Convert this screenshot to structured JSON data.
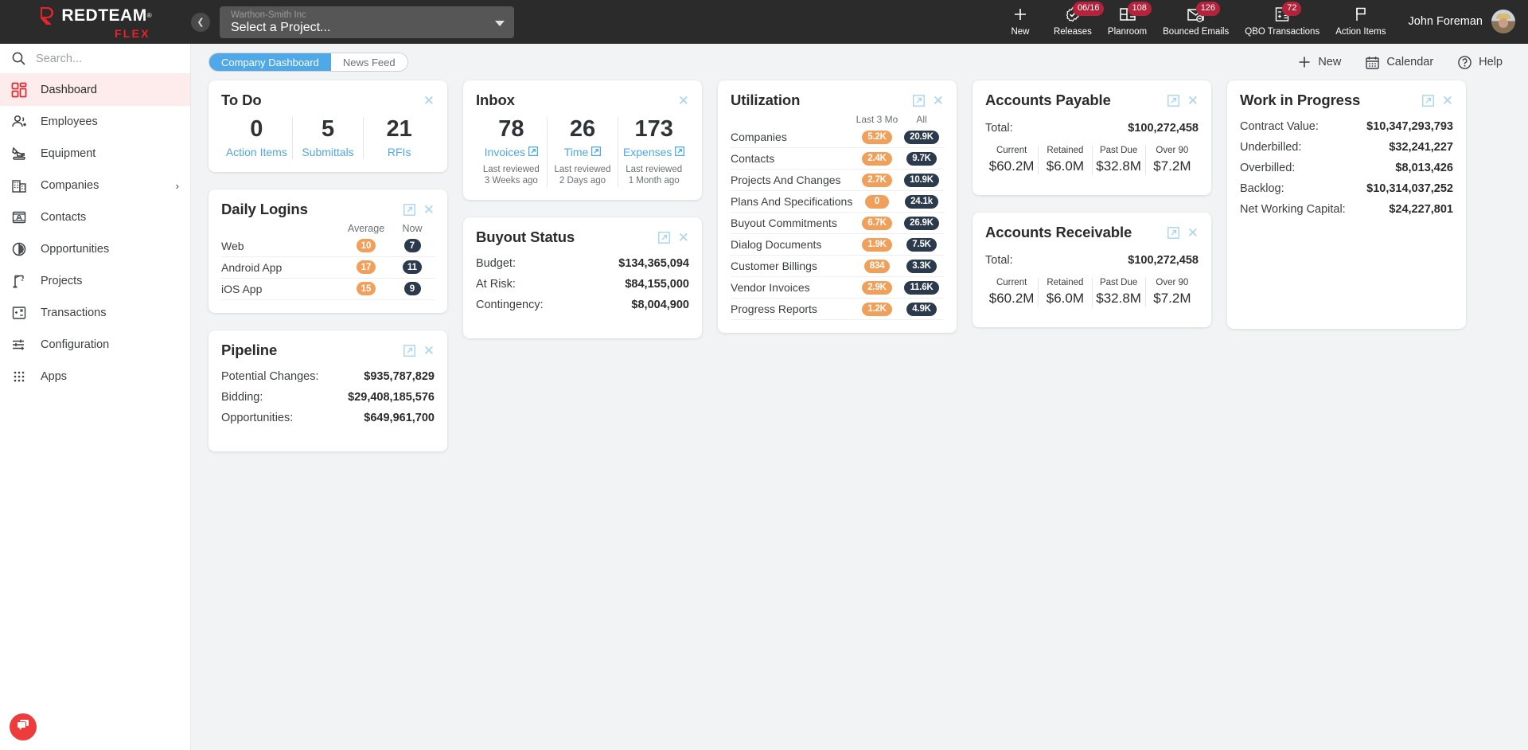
{
  "brand": {
    "name": "REDTEAM",
    "registered": "®",
    "sub": "FLEX",
    "accent": "#e8232a"
  },
  "topbar": {
    "collapse_icon": "chevron-left-icon",
    "project_selector": {
      "company": "Warthon-Smith Inc",
      "value": "Select a Project...",
      "caret_icon": "caret-down-icon"
    },
    "nav": [
      {
        "label": "New",
        "icon": "plus-icon",
        "badge": ""
      },
      {
        "label": "Releases",
        "icon": "badge-check-icon",
        "badge": "06/16"
      },
      {
        "label": "Planroom",
        "icon": "planroom-icon",
        "badge": "108"
      },
      {
        "label": "Bounced Emails",
        "icon": "envelope-minus-icon",
        "badge": "126"
      },
      {
        "label": "QBO Transactions",
        "icon": "calculator-icon",
        "badge": "72"
      },
      {
        "label": "Action Items",
        "icon": "flag-icon",
        "badge": ""
      }
    ],
    "user": {
      "name": "John Foreman",
      "avatar": "avatar"
    }
  },
  "sidebar": {
    "search": {
      "placeholder": "Search...",
      "value": "",
      "icon": "search-icon"
    },
    "items": [
      {
        "label": "Dashboard",
        "icon": "dashboard-icon",
        "active": true,
        "chevron": ""
      },
      {
        "label": "Employees",
        "icon": "employees-icon",
        "active": false,
        "chevron": ""
      },
      {
        "label": "Equipment",
        "icon": "equipment-icon",
        "active": false,
        "chevron": ""
      },
      {
        "label": "Companies",
        "icon": "companies-icon",
        "active": false,
        "chevron": "›"
      },
      {
        "label": "Contacts",
        "icon": "contacts-icon",
        "active": false,
        "chevron": ""
      },
      {
        "label": "Opportunities",
        "icon": "opportunities-icon",
        "active": false,
        "chevron": ""
      },
      {
        "label": "Projects",
        "icon": "projects-icon",
        "active": false,
        "chevron": ""
      },
      {
        "label": "Transactions",
        "icon": "transactions-icon",
        "active": false,
        "chevron": ""
      },
      {
        "label": "Configuration",
        "icon": "configuration-icon",
        "active": false,
        "chevron": ""
      },
      {
        "label": "Apps",
        "icon": "apps-grid-icon",
        "active": false,
        "chevron": ""
      }
    ],
    "chat_button": {
      "icon": "chat-bubble-icon",
      "color": "#ee3b3b"
    }
  },
  "content_header": {
    "tabs": [
      {
        "label": "Company Dashboard",
        "active": true
      },
      {
        "label": "News Feed",
        "active": false
      }
    ],
    "actions": [
      {
        "label": "New",
        "icon": "plus-icon"
      },
      {
        "label": "Calendar",
        "icon": "calendar-icon"
      },
      {
        "label": "Help",
        "icon": "question-circle-icon"
      }
    ],
    "active_tab_color": "#4fa8e8"
  },
  "cards": {
    "todo": {
      "title": "To Do",
      "close_icon": "close-icon",
      "stats": [
        {
          "value": "0",
          "label": "Action Items",
          "external": false
        },
        {
          "value": "5",
          "label": "Submittals",
          "external": false
        },
        {
          "value": "21",
          "label": "RFIs",
          "external": false
        }
      ]
    },
    "inbox": {
      "title": "Inbox",
      "close_icon": "close-icon",
      "stats": [
        {
          "value": "78",
          "label": "Invoices",
          "external": true,
          "sub": "Last reviewed\n3 Weeks ago",
          "sub_line1": "Last reviewed",
          "sub_line2": "3 Weeks ago"
        },
        {
          "value": "26",
          "label": "Time",
          "external": true,
          "sub_line1": "Last reviewed",
          "sub_line2": "2 Days ago"
        },
        {
          "value": "173",
          "label": "Expenses",
          "external": true,
          "sub_line1": "Last reviewed",
          "sub_line2": "1 Month ago"
        }
      ]
    },
    "utilization": {
      "title": "Utilization",
      "expand_icon": "external-link-icon",
      "close_icon": "close-icon",
      "col_headers": [
        "Last 3 Mo",
        "All"
      ],
      "rows": [
        {
          "name": "Companies",
          "last3mo": "5.2K",
          "all": "20.9K"
        },
        {
          "name": "Contacts",
          "last3mo": "2.4K",
          "all": "9.7K"
        },
        {
          "name": "Projects And Changes",
          "last3mo": "2.7K",
          "all": "10.9K"
        },
        {
          "name": "Plans And Specifications",
          "last3mo": "0",
          "all": "24.1k"
        },
        {
          "name": "Buyout Commitments",
          "last3mo": "6.7K",
          "all": "26.9K"
        },
        {
          "name": "Dialog Documents",
          "last3mo": "1.9K",
          "all": "7.5K"
        },
        {
          "name": "Customer Billings",
          "last3mo": "834",
          "all": "3.3K"
        },
        {
          "name": "Vendor Invoices",
          "last3mo": "2.9K",
          "all": "11.6K"
        },
        {
          "name": "Progress Reports",
          "last3mo": "1.2K",
          "all": "4.9K"
        }
      ],
      "pill_colors": {
        "last3mo": "#f0a05a",
        "all": "#2b3a4d"
      }
    },
    "accounts_payable": {
      "title": "Accounts Payable",
      "expand_icon": "external-link-icon",
      "close_icon": "close-icon",
      "total_label": "Total:",
      "total_value": "$100,272,458",
      "buckets": [
        {
          "label": "Current",
          "value": "$60.2M"
        },
        {
          "label": "Retained",
          "value": "$6.0M"
        },
        {
          "label": "Past Due",
          "value": "$32.8M"
        },
        {
          "label": "Over 90",
          "value": "$7.2M"
        }
      ]
    },
    "accounts_receivable": {
      "title": "Accounts Receivable",
      "expand_icon": "external-link-icon",
      "close_icon": "close-icon",
      "total_label": "Total:",
      "total_value": "$100,272,458",
      "buckets": [
        {
          "label": "Current",
          "value": "$60.2M"
        },
        {
          "label": "Retained",
          "value": "$6.0M"
        },
        {
          "label": "Past Due",
          "value": "$32.8M"
        },
        {
          "label": "Over 90",
          "value": "$7.2M"
        }
      ]
    },
    "work_in_progress": {
      "title": "Work in Progress",
      "expand_icon": "external-link-icon",
      "close_icon": "close-icon",
      "rows": [
        {
          "label": "Contract Value:",
          "value": "$10,347,293,793"
        },
        {
          "label": "Underbilled:",
          "value": "$32,241,227"
        },
        {
          "label": "Overbilled:",
          "value": "$8,013,426"
        },
        {
          "label": "Backlog:",
          "value": "$10,314,037,252"
        },
        {
          "label": "Net Working Capital:",
          "value": "$24,227,801"
        }
      ]
    },
    "daily_logins": {
      "title": "Daily Logins",
      "expand_icon": "external-link-icon",
      "close_icon": "close-icon",
      "col_headers": [
        "Average",
        "Now"
      ],
      "rows": [
        {
          "name": "Web",
          "average": "10",
          "now": "7"
        },
        {
          "name": "Android App",
          "average": "17",
          "now": "11"
        },
        {
          "name": "iOS App",
          "average": "15",
          "now": "9"
        }
      ],
      "pill_colors": {
        "average": "#f0a05a",
        "now": "#2b3a4d"
      }
    },
    "buyout_status": {
      "title": "Buyout Status",
      "expand_icon": "external-link-icon",
      "close_icon": "close-icon",
      "rows": [
        {
          "label": "Budget:",
          "value": "$134,365,094"
        },
        {
          "label": "At Risk:",
          "value": "$84,155,000"
        },
        {
          "label": "Contingency:",
          "value": "$8,004,900"
        }
      ]
    },
    "pipeline": {
      "title": "Pipeline",
      "expand_icon": "external-link-icon",
      "close_icon": "close-icon",
      "rows": [
        {
          "label": "Potential Changes:",
          "value": "$935,787,829"
        },
        {
          "label": "Bidding:",
          "value": "$29,408,185,576"
        },
        {
          "label": "Opportunities:",
          "value": "$649,961,700"
        }
      ]
    }
  }
}
